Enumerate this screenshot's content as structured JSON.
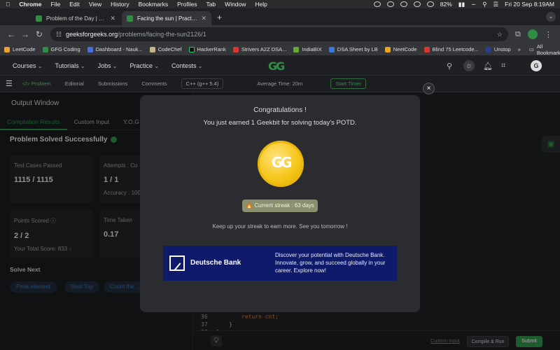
{
  "menubar": {
    "apple": "",
    "app": "Chrome",
    "items": [
      "File",
      "Edit",
      "View",
      "History",
      "Bookmarks",
      "Profiles",
      "Tab",
      "Window",
      "Help"
    ],
    "battery": "82%",
    "datetime": "Fri 20 Sep  8:19AM"
  },
  "tabs": [
    {
      "title": "Problem of the Day | Geeksfor",
      "active": false
    },
    {
      "title": "Facing the sun | Practice | Ge",
      "active": true
    }
  ],
  "address": {
    "host": "geeksforgeeks.org",
    "path": "/problems/facing-the-sun2126/1"
  },
  "bookmarks": [
    "LeetCode",
    "GFG Coding",
    "Dashboard - Nauk...",
    "CodeChef",
    "HackerRank",
    "Strivers A2Z DSA...",
    "IndiaBIX",
    "DSA Sheet by LB",
    "NeetCode",
    "Blind 75 Leetcode...",
    "Unstop"
  ],
  "bookmarks_overflow": "»",
  "all_bookmarks": "All Bookmarks",
  "gfg_nav": [
    "Courses",
    "Tutorials",
    "Jobs",
    "Practice",
    "Contests"
  ],
  "gfg_logo": "GG",
  "user_initial": "G",
  "subbar": {
    "tabs": [
      "Problem",
      "Editorial",
      "Submissions",
      "Comments"
    ],
    "language": "C++ (g++ 5.4)",
    "average_time": "Average Time: 20m",
    "timer": "Start Timer"
  },
  "left_panel": {
    "title": "Output Window",
    "tabs": [
      "Compilation Results",
      "Custom Input",
      "Y.O.G"
    ],
    "status": "Problem Solved Successfully",
    "cards": {
      "test_cases_label": "Test Cases Passed",
      "test_cases_value": "1115 / 1115",
      "attempts_label": "Attempts : Co",
      "attempts_value": "1 / 1",
      "accuracy": "Accuracy : 100",
      "points_label": "Points Scored",
      "points_value": "2 / 2",
      "total_score": "Your Total Score: 833",
      "time_label": "Time Taken",
      "time_value": "0.17"
    },
    "solve_next": "Solve Next",
    "next_problems": [
      "Peak element",
      "Root Top",
      "Count the ..."
    ]
  },
  "editor": {
    "lines": [
      {
        "num": "36",
        "code": "return cnt;"
      },
      {
        "num": "37",
        "code": "}"
      },
      {
        "num": "38",
        "code": "};"
      }
    ],
    "custom_input": "Custom Input",
    "compile_run": "Compile & Run",
    "submit": "Submit"
  },
  "modal": {
    "close": "×",
    "congrats": "Congratulations !",
    "earned": "You just earned 1 Geekbit for solving today's POTD.",
    "coin_mark": "GG",
    "streak": "🔥 Current streak : 63 days",
    "keep_up": "Keep up your streak to earn more. See you tomorrow !",
    "ad": {
      "brand": "Deutsche Bank",
      "text": "Discover your potential with Deutsche Bank. Innovate, grow, and succeed globally in your career. Explore now!"
    }
  },
  "colors": {
    "gfg_green": "#2f8d46",
    "coin_gold": "#f5c518",
    "ad_blue": "#0f1a6b",
    "modal_bg": "#2b2c30"
  }
}
